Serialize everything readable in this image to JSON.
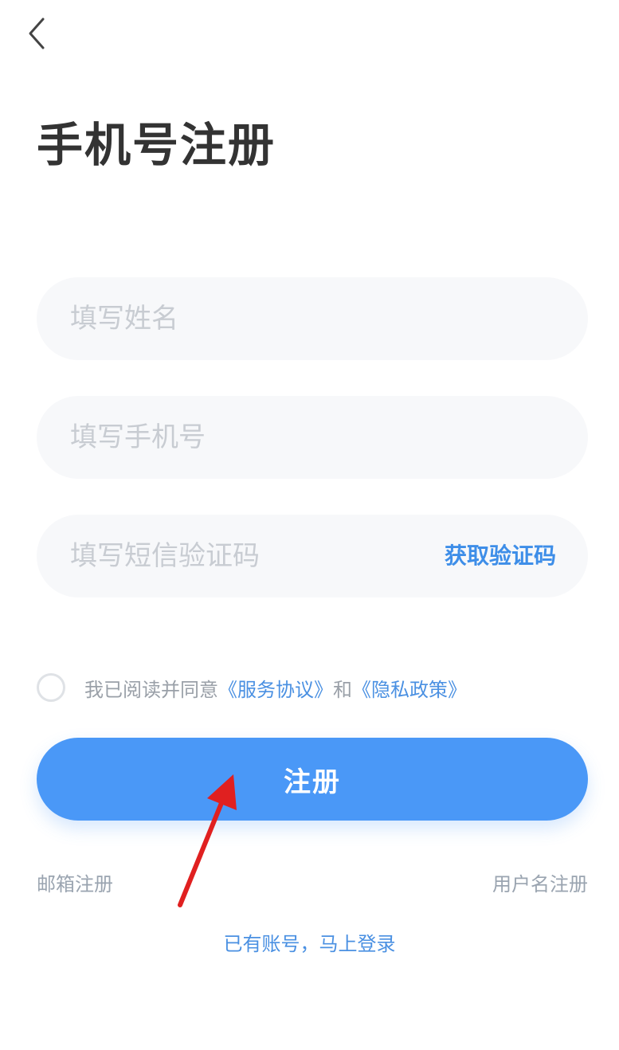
{
  "header": {
    "back_icon": "chevron-left-icon",
    "title": "手机号注册"
  },
  "form": {
    "name_placeholder": "填写姓名",
    "name_value": "",
    "phone_placeholder": "填写手机号",
    "phone_value": "",
    "code_placeholder": "填写短信验证码",
    "code_value": "",
    "get_code_label": "获取验证码"
  },
  "agreement": {
    "checked": false,
    "prefix": "我已阅读并同意",
    "service_link": "《服务协议》",
    "conjunction": "和",
    "privacy_link": "《隐私政策》"
  },
  "actions": {
    "register_label": "注册",
    "email_register": "邮箱注册",
    "username_register": "用户名注册",
    "login_link": "已有账号，马上登录"
  },
  "colors": {
    "primary": "#4a98f7",
    "link": "#4a90e2",
    "title": "#333333",
    "annotation_arrow": "#e02020"
  }
}
